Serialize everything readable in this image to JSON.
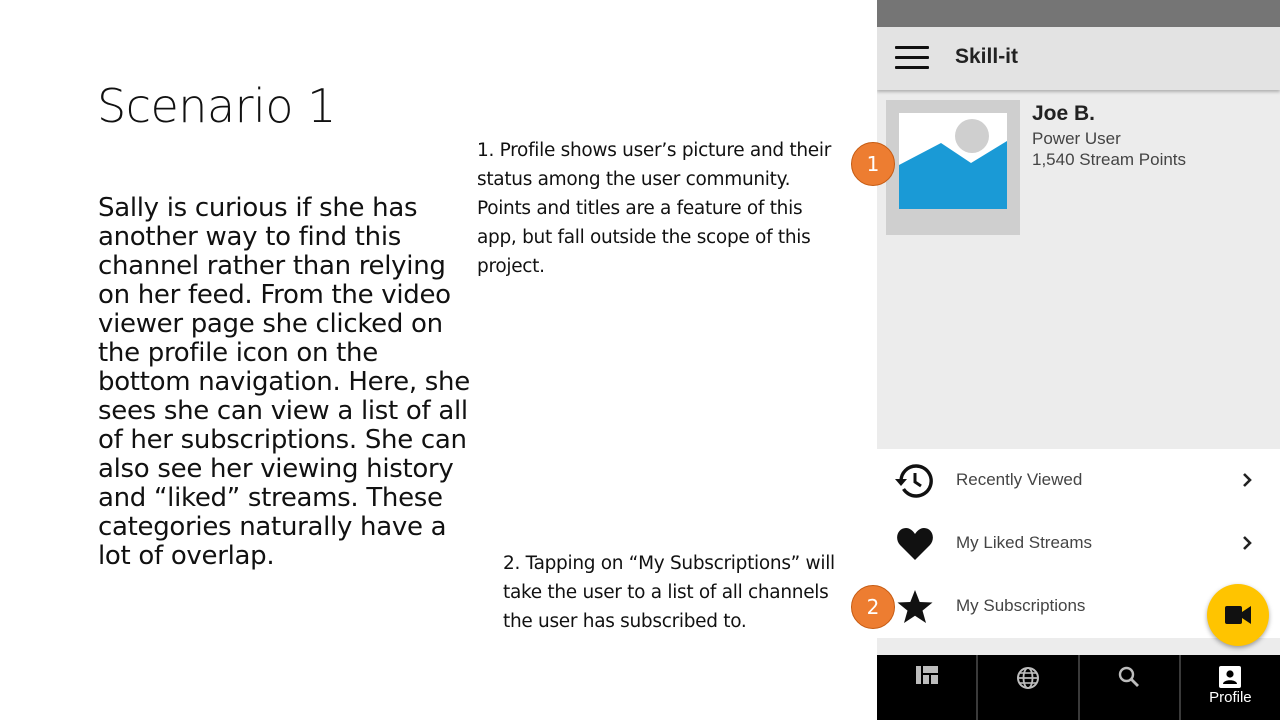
{
  "slide": {
    "title": "Scenario 1",
    "body": "Sally is curious if she has another way to find this channel rather than relying on her feed. From the video viewer page she clicked on the profile icon on the bottom navigation. Here, she sees she can view a list of all of her subscriptions. She can also see her viewing history and “liked” streams. These categories naturally have a lot of overlap.",
    "note_1": "1. Profile shows user’s picture and their status among the user community. Points and titles are a feature of this app, but fall outside the scope of this project.",
    "note_2": "2. Tapping on “My Subscriptions” will take the user to a list of all channels the user has subscribed to."
  },
  "callouts": [
    "1",
    "2"
  ],
  "app": {
    "title": "Skill-it",
    "menu_icon": "hamburger-menu-icon",
    "profile": {
      "name": "Joe B.",
      "status": "Power User",
      "points": "1,540 Stream Points",
      "avatar_icon": "image-placeholder-icon"
    },
    "list": [
      {
        "label": "Recently Viewed",
        "icon": "history-icon",
        "chevron": true
      },
      {
        "label": "My Liked Streams",
        "icon": "heart-icon",
        "chevron": true
      },
      {
        "label": "My Subscriptions",
        "icon": "star-icon",
        "chevron": false
      }
    ],
    "fab_icon": "videocam-icon",
    "bottom_nav": [
      {
        "icon": "dashboard-icon",
        "label": ""
      },
      {
        "icon": "globe-icon",
        "label": ""
      },
      {
        "icon": "search-icon",
        "label": ""
      },
      {
        "icon": "profile-icon",
        "label": "Profile"
      }
    ],
    "colors": {
      "status_bar": "#757575",
      "app_bar": "#e3e3e3",
      "background": "#ececec",
      "avatar_frame": "#cfcfcf",
      "avatar_blue": "#1a9ad6",
      "fab": "#ffc400",
      "callout": "#ed7d31",
      "bottom_nav": "#000000"
    }
  }
}
